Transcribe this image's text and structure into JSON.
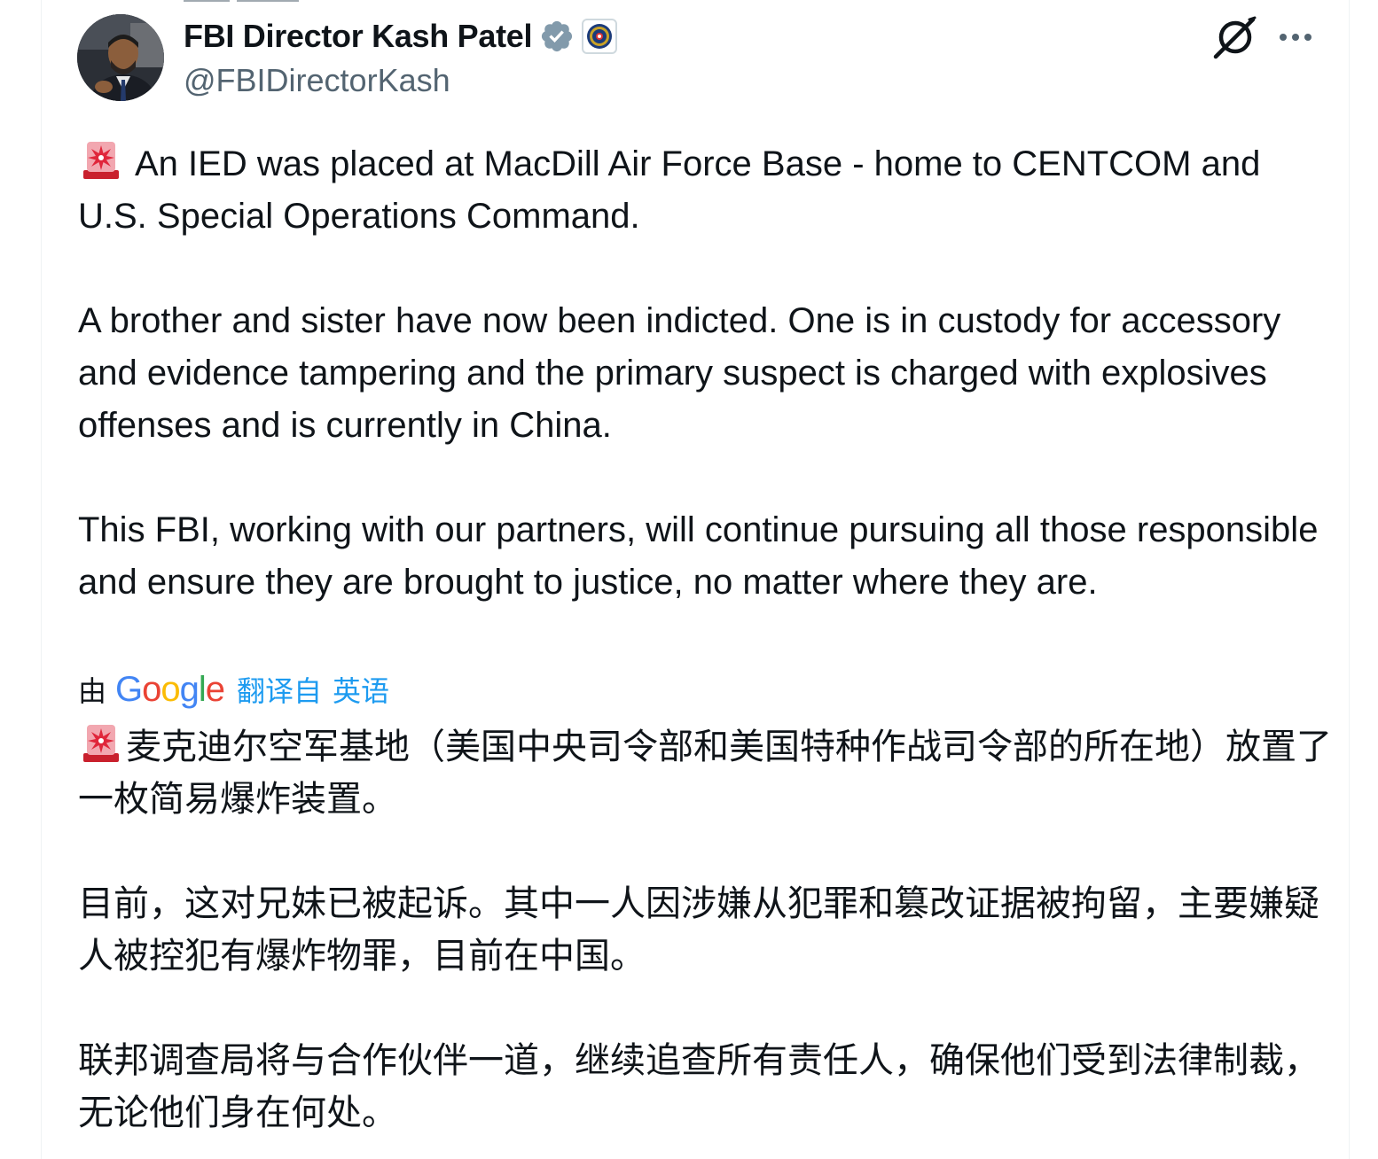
{
  "author": {
    "display_name": "FBI Director Kash Patel",
    "handle": "@FBIDirectorKash",
    "verified_badge_color": "#829aab",
    "icons": [
      "verified-badge-icon",
      "fbi-seal-icon"
    ]
  },
  "header_actions": {
    "icons": [
      "grok-icon",
      "more-options-icon"
    ]
  },
  "tweet": {
    "paragraphs": [
      "An IED was placed at MacDill Air Force Base - home to CENTCOM and U.S. Special Operations Command.",
      "A brother and sister have now been indicted. One is in custody for accessory and evidence tampering and the primary suspect is charged with explosives offenses and is currently in China.",
      "This FBI, working with our partners, will continue pursuing all those responsible and ensure they are brought to justice, no matter where they are."
    ],
    "leading_emoji": "siren-icon"
  },
  "translation": {
    "by_label": "由",
    "provider": "Google",
    "action_label": "翻译自",
    "source_language": "英语",
    "link_color": "#1d9bf0",
    "paragraphs": [
      "麦克迪尔空军基地（美国中央司令部和美国特种作战司令部的所在地）放置了一枚简易爆炸装置。",
      "目前，这对兄妹已被起诉。其中一人因涉嫌从犯罪和篡改证据被拘留，主要嫌疑人被控犯有爆炸物罪，目前在中国。",
      "联邦调查局将与合作伙伴一道，继续追查所有责任人，确保他们受到法律制裁，无论他们身在何处。"
    ]
  }
}
